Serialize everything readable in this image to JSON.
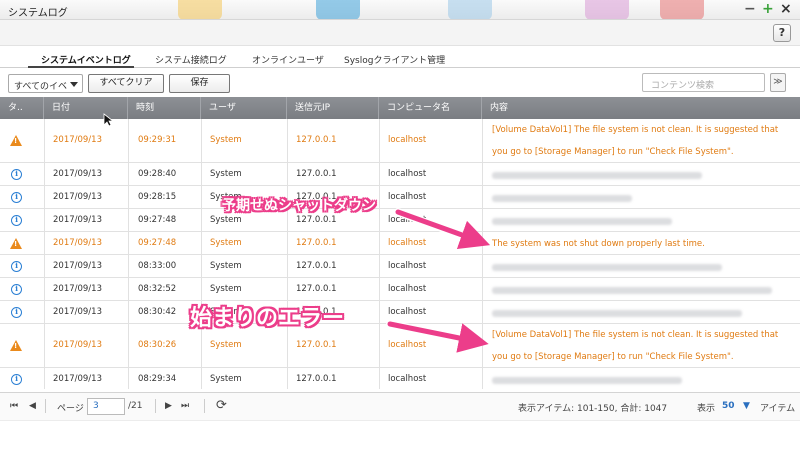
{
  "window": {
    "title": "システムログ",
    "minimize": "−",
    "maximize": "+",
    "close": "×",
    "help": "?"
  },
  "tabs": [
    "システムイベントログ",
    "システム接続ログ",
    "オンラインユーザ",
    "Syslogクライアント管理"
  ],
  "toolbar": {
    "filter_value": "すべてのイベ",
    "clear_label": "すべてクリア",
    "save_label": "保存",
    "search_placeholder": "コンテンツ検索",
    "expand_glyph": "≫"
  },
  "columns": [
    "タ..",
    "日付",
    "時刻",
    "ユーザ",
    "送信元IP",
    "コンピュータ名",
    "内容"
  ],
  "rows": [
    {
      "type": "warning",
      "date": "2017/09/13",
      "time": "09:29:31",
      "user": "System",
      "ip": "127.0.0.1",
      "host": "localhost",
      "content": "[Volume DataVol1] The file system is not clean. It is suggested that you go to [Storage Manager] to run \"Check File System\"."
    },
    {
      "type": "info",
      "date": "2017/09/13",
      "time": "09:28:40",
      "user": "System",
      "ip": "127.0.0.1",
      "host": "localhost",
      "content": ""
    },
    {
      "type": "info",
      "date": "2017/09/13",
      "time": "09:28:15",
      "user": "System",
      "ip": "127.0.0.1",
      "host": "localhost",
      "content": ""
    },
    {
      "type": "info",
      "date": "2017/09/13",
      "time": "09:27:48",
      "user": "System",
      "ip": "127.0.0.1",
      "host": "localhost",
      "content": ""
    },
    {
      "type": "warning",
      "date": "2017/09/13",
      "time": "09:27:48",
      "user": "System",
      "ip": "127.0.0.1",
      "host": "localhost",
      "content": "The system was not shut down properly last time."
    },
    {
      "type": "info",
      "date": "2017/09/13",
      "time": "08:33:00",
      "user": "System",
      "ip": "127.0.0.1",
      "host": "localhost",
      "content": ""
    },
    {
      "type": "info",
      "date": "2017/09/13",
      "time": "08:32:52",
      "user": "System",
      "ip": "127.0.0.1",
      "host": "localhost",
      "content": ""
    },
    {
      "type": "info",
      "date": "2017/09/13",
      "time": "08:30:42",
      "user": "System",
      "ip": "127.0.0.1",
      "host": "localhost",
      "content": ""
    },
    {
      "type": "warning",
      "date": "2017/09/13",
      "time": "08:30:26",
      "user": "System",
      "ip": "127.0.0.1",
      "host": "localhost",
      "content": "[Volume DataVol1] The file system is not clean. It is suggested that you go to [Storage Manager] to run \"Check File System\"."
    },
    {
      "type": "info",
      "date": "2017/09/13",
      "time": "08:29:34",
      "user": "System",
      "ip": "127.0.0.1",
      "host": "localhost",
      "content": ""
    }
  ],
  "annotations": {
    "unexpected_shutdown": "予期せぬシャットダウン",
    "first_error": "始まりのエラー"
  },
  "pager": {
    "first": "⏮",
    "prev": "◀",
    "page_label": "ページ",
    "page_value": "3",
    "total_pages": "/21",
    "next": "▶",
    "last": "⏭",
    "refresh": "⟳",
    "items_info": "表示アイテム: 101-150, 合計: 1047",
    "display_label": "表示",
    "per_page": "50",
    "items_suffix": "アイテム"
  },
  "colors": {
    "warning": "#e07b12",
    "info": "#2a7fd4",
    "header": "#85888d",
    "annotation": "#ec3d8a"
  }
}
